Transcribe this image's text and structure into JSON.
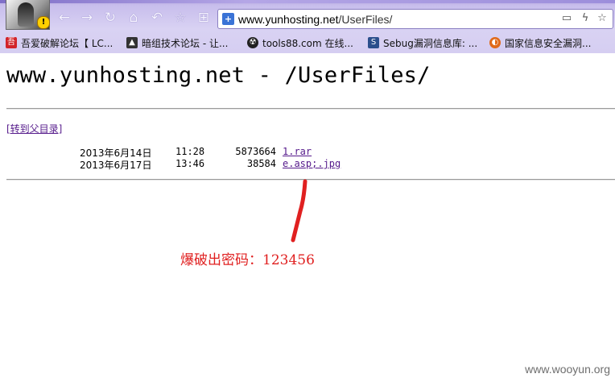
{
  "browser": {
    "address_bar": {
      "host": "www.yunhosting.net",
      "path": "/UserFiles/"
    },
    "nav_icons": [
      "back-icon",
      "forward-icon",
      "reload-icon",
      "home-icon",
      "undo-icon",
      "star-icon",
      "apps-icon"
    ],
    "bookmarks": [
      {
        "label": "吾爱破解论坛【 LC...",
        "icon": "52pojie-icon"
      },
      {
        "label": "暗组技术论坛 - 让...",
        "icon": "darkteam-icon"
      },
      {
        "label": "tools88.com 在线...",
        "icon": "radiation-icon"
      },
      {
        "label": "Sebug漏洞信息库: ...",
        "icon": "sebug-icon"
      },
      {
        "label": "国家信息安全漏洞...",
        "icon": "cnvd-icon"
      }
    ]
  },
  "page": {
    "title": "www.yunhosting.net - /UserFiles/",
    "parent_link": "[转到父目录]",
    "files": [
      {
        "date": "2013年6月14日",
        "time": "11:28",
        "size": "5873664",
        "name": "1.rar"
      },
      {
        "date": "2013年6月17日",
        "time": "13:46",
        "size": "38584",
        "name": "e.asp;.jpg"
      }
    ]
  },
  "annotation": {
    "text": "爆破出密码：123456",
    "color": "#e02020"
  },
  "watermark": "www.wooyun.org"
}
